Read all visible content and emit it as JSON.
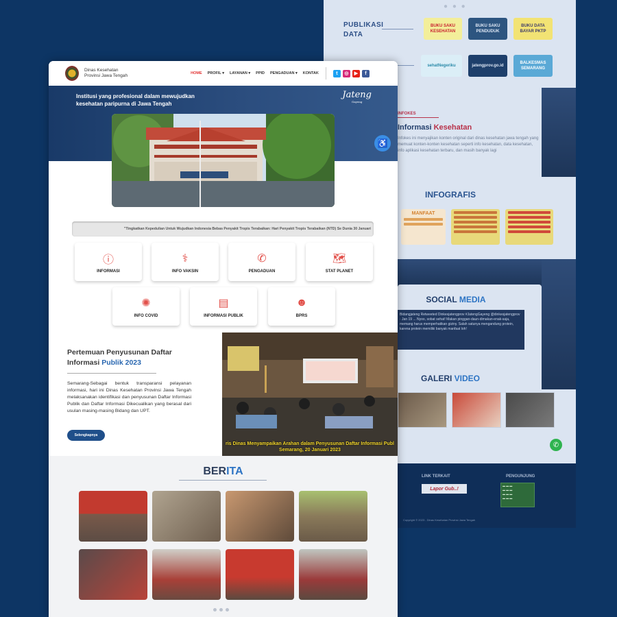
{
  "back": {
    "pub_title": "PUBLIKASI\nDATA",
    "pub_cards": [
      {
        "label": "BUKU SAKU KESEHATAN",
        "bg": "#f3ee9a",
        "fg": "#c8202f"
      },
      {
        "label": "BUKU SAKU PENDUDUK",
        "bg": "#2d5580",
        "fg": "#dfe8f5"
      },
      {
        "label": "BUKU DATA BAYAR PKTP",
        "bg": "#f2e374",
        "fg": "#3c3a6b"
      },
      {
        "label": "sehatNegeriku",
        "bg": "#dbeef7",
        "fg": "#2a8aa9"
      },
      {
        "label": "jatengprov.go.id",
        "bg": "#1e3f6b",
        "fg": "#dce6f4"
      },
      {
        "label": "BALKESMAS SEMARANG",
        "bg": "#5aa9d6",
        "fg": "#ffffff"
      }
    ],
    "infokes": {
      "tag": "INFOKES",
      "title_a": "Informasi",
      "title_b": "Kesehatan",
      "body": "Infokes ini menyajikan konten original dari dinas kesehatan jawa tengah yang memuat konten-konten kesehatan seperti info kesehatan, data kesehatan, info aplikasi kesehatan terbaru, dan masih banyak lagi"
    },
    "infografis": "INFOGRAFIS",
    "infog_first": "MANFAAT",
    "social_a": "SOCIAL",
    "social_b": "MEDIA",
    "tweet": "Bidangjateng Retweeted Dinkesjatengprov #JatengGayeng @dinkesjatengprov · Jan 19 ... Nyoo, sobat sehat! Makan pinggan-daun-dimakan-enak-saja, memang harus memperhatikan giziny. Salah satunya mengandung protein, karena protein memiliki banyak manfaat loh!",
    "galeri_a": "GALERI",
    "galeri_b": "VIDEO",
    "link_terkait": "LINK TERKAIT",
    "lapor": "Lapor Gub..!",
    "pengunjung": "PENGUNJUNG",
    "copyright": "Copyright © 2023 - Dinas Kesehatan Provinsi Jawa Tengah"
  },
  "nav": {
    "org_line1": "Dinas Kesehatan",
    "org_line2": "Provinsi Jawa Tengah",
    "menu": [
      "HOME",
      "PROFIL ▾",
      "LAYANAN ▾",
      "PPID",
      "PENGADUAN ▾",
      "KONTAK"
    ]
  },
  "hero": {
    "caption": "Institusi yang profesional dalam mewujudkan kesehatan paripurna di Jawa Tengah",
    "brand": "Jateng",
    "brand_sub": "Gayeng"
  },
  "ticker": "\"Tingkatkan Kepedulian Untuk Wujudkan Indonesia Bebas Penyakit Tropis Terabaikan: Hari Penyakit Tropis Terabaikan (NTD) Se Dunia 30 Januari",
  "services": [
    {
      "label": "INFORMASI",
      "icon": "info-icon",
      "glyph": "ⓘ"
    },
    {
      "label": "INFO VAKSIN",
      "icon": "vaccine-icon",
      "glyph": "⚕"
    },
    {
      "label": "PENGADUAN",
      "icon": "phone-icon",
      "glyph": "✆"
    },
    {
      "label": "STAT PLANET",
      "icon": "world-map-icon",
      "glyph": "🗺"
    },
    {
      "label": "INFO COVID",
      "icon": "virus-icon",
      "glyph": "✺"
    },
    {
      "label": "INFORMASI PUBLIK",
      "icon": "document-icon",
      "glyph": "▤"
    },
    {
      "label": "BPRS",
      "icon": "people-icon",
      "glyph": "☻"
    }
  ],
  "article": {
    "title_a": "Pertemuan Penyusunan Daftar Informasi",
    "title_b": "Publik 2023",
    "body": "Semarang-Sebagai bentuk transparansi pelayanan informasi, hari ini Dinas Kesehatan Provinsi Jawa Tengah melaksanakan identifikasi dan penyusunan Daftar Informasi Publik dan Daftar Informasi Dikecualikan yang berasal dari usulan masing-masing Bidang dan UPT.",
    "button": "Selengkapnya",
    "photo_caption_1": "ris Dinas Menyampaikan Arahan dalam Penyusunan Daftar Informasi Publ",
    "photo_caption_2": "Semarang, 20 Januari 2023"
  },
  "berita": {
    "title_a": "BER",
    "title_b": "ITA"
  },
  "colors": {
    "accent_red": "#e23232",
    "brand_blue": "#1f4f8a",
    "page_bg": "#0d3564"
  }
}
